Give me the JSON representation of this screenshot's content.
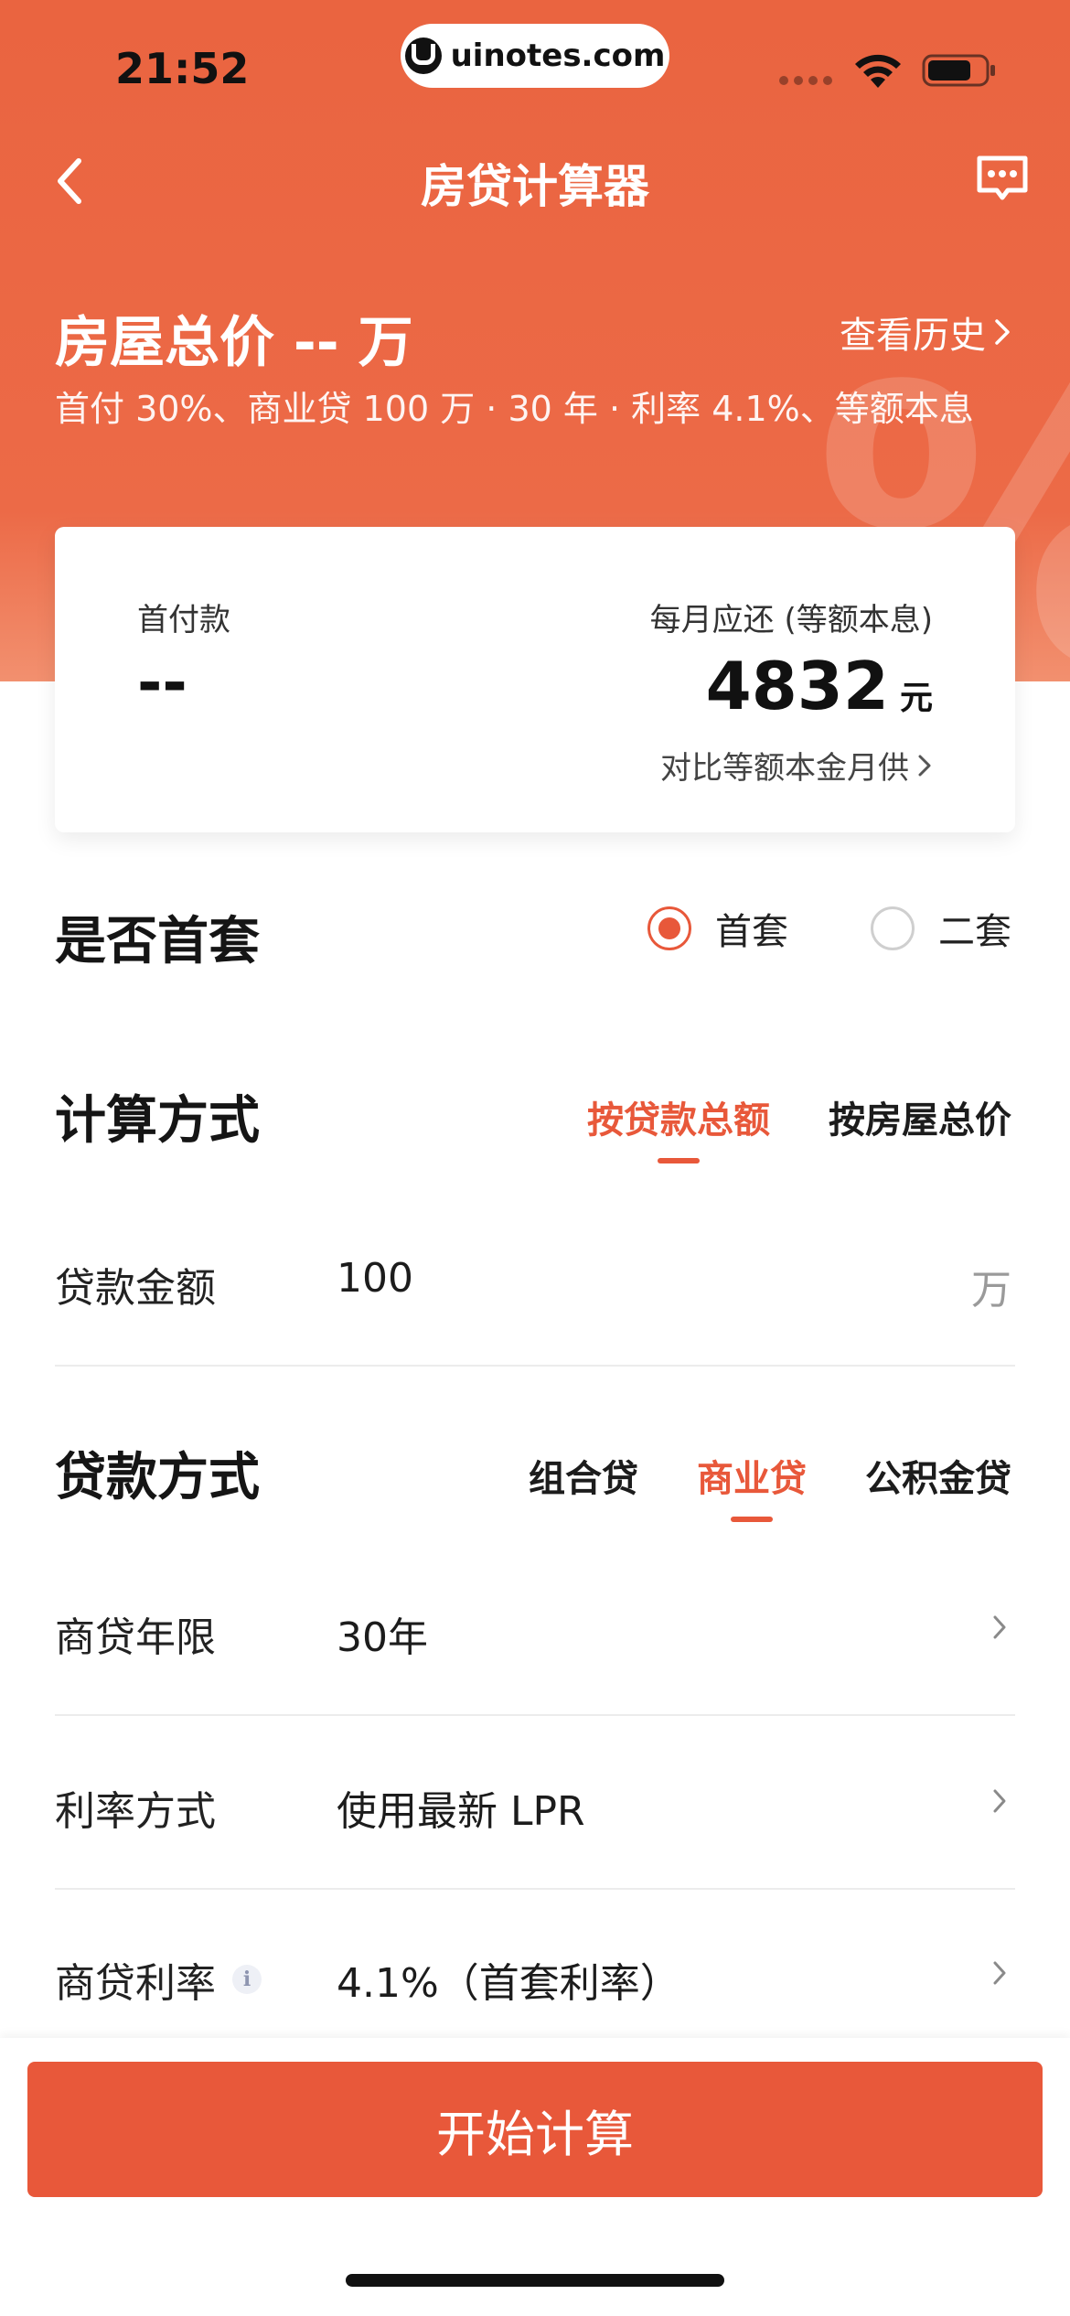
{
  "status_bar": {
    "time": "21:52",
    "url": "uinotes.com"
  },
  "nav": {
    "title": "房贷计算器",
    "back_icon": "chevron-left-icon",
    "message_icon": "message-dots-icon"
  },
  "header": {
    "price_title": "房屋总价 -- 万",
    "history_label": "查看历史",
    "summary_line": "首付 30%、商业贷 100 万 · 30 年 · 利率 4.1%、等额本息"
  },
  "summary_card": {
    "down_payment_label": "首付款",
    "down_payment_value": "--",
    "monthly_label": "每月应还 (等额本息)",
    "monthly_value": "4832",
    "monthly_unit": "元",
    "compare_label": "对比等额本金月供"
  },
  "first_home": {
    "title": "是否首套",
    "options": [
      "首套",
      "二套"
    ],
    "selected": "首套"
  },
  "calc_method": {
    "title": "计算方式",
    "tabs": [
      "按贷款总额",
      "按房屋总价"
    ],
    "active": "按贷款总额"
  },
  "loan_amount": {
    "label": "贷款金额",
    "value": "100",
    "unit": "万"
  },
  "loan_type": {
    "title": "贷款方式",
    "tabs": [
      "组合贷",
      "商业贷",
      "公积金贷"
    ],
    "active": "商业贷"
  },
  "rows": [
    {
      "label": "商贷年限",
      "value": "30年"
    },
    {
      "label": "利率方式",
      "value": "使用最新 LPR"
    },
    {
      "label": "商贷利率",
      "value": "4.1%（首套利率）"
    }
  ],
  "info_icon_text": "i",
  "action": {
    "start_label": "开始计算"
  },
  "colors": {
    "brand": "#e8583a",
    "header_bg": "#ec6a47"
  }
}
